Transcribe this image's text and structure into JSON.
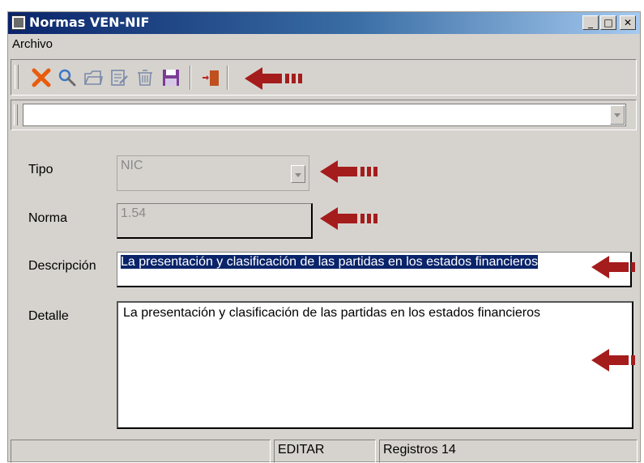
{
  "window": {
    "title": "Normas VEN-NIF"
  },
  "titlebar": {
    "minimize_glyph": "_",
    "maximize_glyph": "□",
    "close_glyph": "✕"
  },
  "menu": {
    "items": [
      {
        "label": "Archivo"
      }
    ]
  },
  "toolbar": {
    "buttons": [
      {
        "icon": "delete-icon",
        "color": "#e85c0c"
      },
      {
        "icon": "search-icon",
        "color": "#3a78c8"
      },
      {
        "icon": "open-folder-icon",
        "color": "#7a8aa8"
      },
      {
        "icon": "edit-icon",
        "color": "#7a8aa8"
      },
      {
        "icon": "trash-icon",
        "color": "#7a8aa8"
      },
      {
        "icon": "save-icon",
        "color": "#7b3d94"
      },
      {
        "icon": "exit-door-icon",
        "color": "#c0501f"
      }
    ]
  },
  "top_combo": {
    "value": ""
  },
  "form": {
    "tipo": {
      "label": "Tipo",
      "value": "NIC"
    },
    "norma": {
      "label": "Norma",
      "value": "1.54"
    },
    "descripcion": {
      "label": "Descripción",
      "value": "La presentación y clasificación de las partidas en los estados financieros"
    },
    "detalle": {
      "label": "Detalle",
      "value": "La presentación y clasificación de las partidas en los estados financieros"
    }
  },
  "status": {
    "panel_1": "",
    "mode": "EDITAR",
    "registros": "Registros 14"
  },
  "annotation_color": "#a51c1c"
}
